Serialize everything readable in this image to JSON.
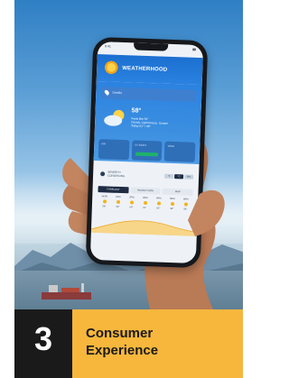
{
  "app": {
    "logo_text": "WEATHERHOOD",
    "status_time": "9:41",
    "location_placeholder": "Seattle",
    "current": {
      "temperature": "58°",
      "feels_like": "Feels like 55°",
      "summary": "Cloudy. Light breeze. Sunset",
      "detail": "Today 61° / 49°"
    },
    "cards": [
      {
        "label": "AIR"
      },
      {
        "label": "UV INDEX"
      },
      {
        "label": "WIND"
      }
    ],
    "info": {
      "line1": "SEVERITY",
      "line2": "CONDITIONS",
      "toggle": [
        "°F",
        "°C",
        "MIX"
      ]
    },
    "tabs": [
      "FORECAST",
      "HOURLY DATA",
      "MAP"
    ],
    "hours": [
      {
        "time": "NOW",
        "temp": "58°"
      },
      {
        "time": "1PM",
        "temp": "59°"
      },
      {
        "time": "2PM",
        "temp": "60°"
      },
      {
        "time": "3PM",
        "temp": "61°"
      },
      {
        "time": "4PM",
        "temp": "60°"
      },
      {
        "time": "5PM",
        "temp": "58°"
      },
      {
        "time": "6PM",
        "temp": "56°"
      }
    ]
  },
  "caption": {
    "number": "3",
    "line1": "Consumer",
    "line2": "Experience",
    "accent_color": "#f6b73c",
    "number_bg": "#1a1a1a"
  }
}
